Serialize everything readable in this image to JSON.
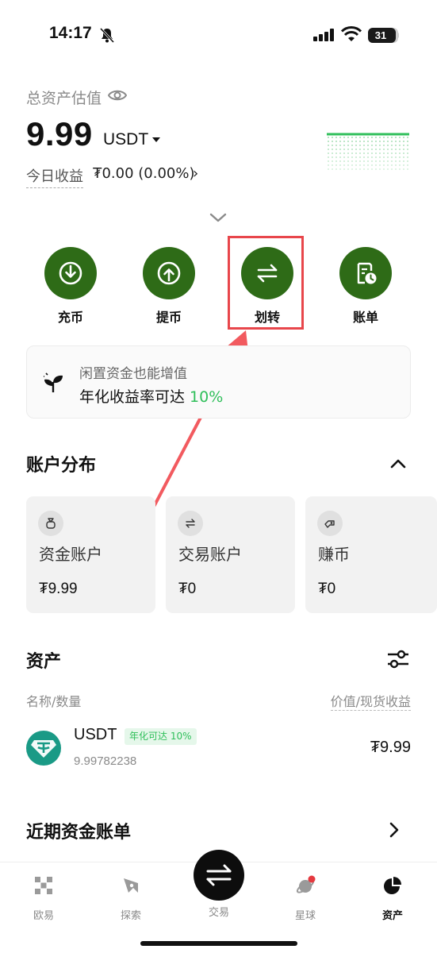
{
  "status_bar": {
    "time": "14:17",
    "battery": "31",
    "battery_level": 0.31
  },
  "header": {
    "total_label": "总资产估值",
    "total_value": "9.99",
    "currency": "USDT",
    "today_label": "今日收益",
    "today_value": "₮0.00 (0.00%)",
    "today_arrow": "›"
  },
  "actions": [
    {
      "label": "充币",
      "icon": "download-icon"
    },
    {
      "label": "提币",
      "icon": "upload-icon"
    },
    {
      "label": "划转",
      "icon": "transfer-icon"
    },
    {
      "label": "账单",
      "icon": "bill-icon"
    }
  ],
  "promo": {
    "title": "闲置资金也能增值",
    "text": "年化收益率可达 ",
    "rate": "10%"
  },
  "accounts": {
    "title": "账户分布",
    "cards": [
      {
        "name": "资金账户",
        "value": "₮9.99",
        "icon": "bag-icon"
      },
      {
        "name": "交易账户",
        "value": "₮0",
        "icon": "swap-icon"
      },
      {
        "name": "赚币",
        "value": "₮0",
        "icon": "coin-icon"
      }
    ]
  },
  "assets": {
    "title": "资产",
    "col_left": "名称/数量",
    "col_right": "价值/现货收益",
    "rows": [
      {
        "symbol": "USDT",
        "badge": "年化可达 10%",
        "amount": "9.99782238",
        "value": "₮9.99"
      }
    ]
  },
  "recent": {
    "title": "近期资金账单",
    "arrow": "›"
  },
  "nav": {
    "items": [
      {
        "label": "欧易",
        "icon": "okx-logo-icon"
      },
      {
        "label": "探索",
        "icon": "compass-icon"
      },
      {
        "label": "交易",
        "icon": "trade-swap-icon"
      },
      {
        "label": "星球",
        "icon": "planet-icon"
      },
      {
        "label": "资产",
        "icon": "pie-chart-icon"
      }
    ],
    "active": "资产"
  },
  "colors": {
    "accent_green": "#2e6b17",
    "highlight_red": "#e8464b",
    "positive_green": "#2fbf5a",
    "usdt_teal": "#1a9a86"
  }
}
